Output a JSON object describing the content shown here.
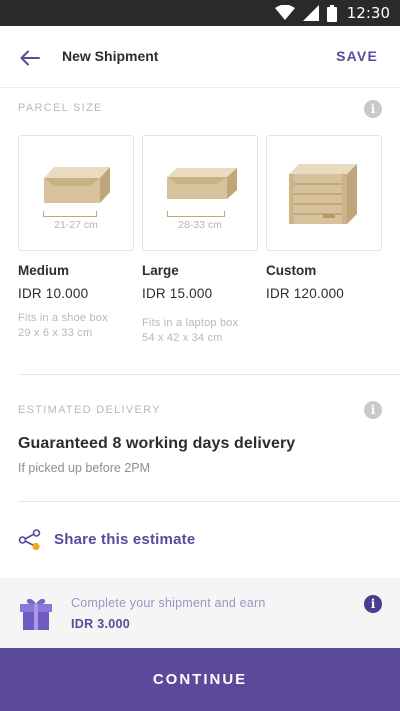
{
  "status_bar": {
    "time": "12:30",
    "icons": [
      "wifi-icon",
      "cellular-signal-icon",
      "battery-icon"
    ]
  },
  "app_bar": {
    "title": "New Shipment",
    "save_label": "SAVE",
    "back_icon": "arrow-back-icon"
  },
  "parcel_size": {
    "label": "PARCEL SIZE",
    "options": [
      {
        "name": "Medium",
        "price": "IDR 10.000",
        "measure": "21-27 cm",
        "desc_line1": "Fits in a shoe box",
        "desc_line2": "29 x 6 x 33 cm",
        "icon": "flat-box-icon"
      },
      {
        "name": "Large",
        "price": "IDR 15.000",
        "measure": "28-33 cm",
        "desc_line1": "Fits in a laptop box",
        "desc_line2": "54 x 42 x 34 cm",
        "icon": "flat-box-icon"
      },
      {
        "name": "Custom",
        "price": "IDR 120.000",
        "icon": "wooden-crate-icon"
      }
    ]
  },
  "estimated_delivery": {
    "label": "ESTIMATED DELIVERY",
    "title": "Guaranteed 8 working days delivery",
    "subtitle": "If picked up before 2PM"
  },
  "share": {
    "label": "Share this estimate",
    "icon": "share-icon"
  },
  "promo": {
    "text": "Complete your shipment and earn",
    "amount": "IDR 3.000",
    "icon": "gift-icon"
  },
  "continue_label": "CONTINUE",
  "colors": {
    "accent": "#5b4a9c",
    "status_bar": "#2a2a2a",
    "box": "#d8c3a0",
    "share_dot": "#f5a623"
  }
}
